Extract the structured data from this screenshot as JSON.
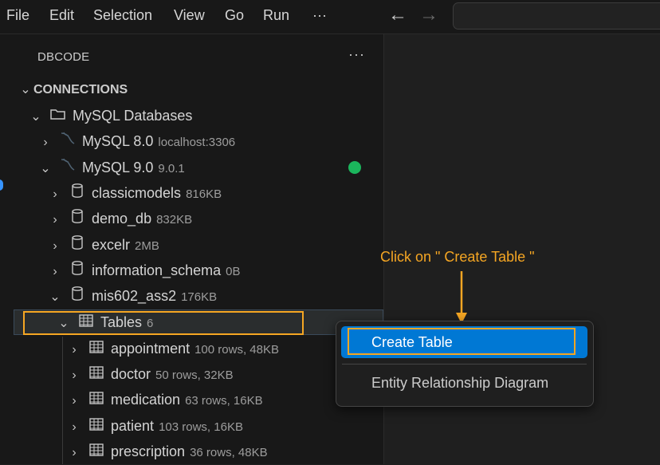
{
  "menubar": {
    "items": [
      "File",
      "Edit",
      "Selection",
      "View",
      "Go",
      "Run"
    ],
    "more": "···",
    "back": "←",
    "forward": "→"
  },
  "sidebar": {
    "title": "DBCODE",
    "more": "···",
    "section": "CONNECTIONS",
    "group": "MySQL Databases",
    "connections": [
      {
        "name": "MySQL 8.0",
        "desc": "localhost:3306",
        "expanded": false
      },
      {
        "name": "MySQL 9.0",
        "desc": "9.0.1",
        "expanded": true,
        "status_color": "#1bb55c"
      }
    ],
    "databases": [
      {
        "name": "classicmodels",
        "size": "816KB",
        "expanded": false
      },
      {
        "name": "demo_db",
        "size": "832KB",
        "expanded": false
      },
      {
        "name": "excelr",
        "size": "2MB",
        "expanded": false
      },
      {
        "name": "information_schema",
        "size": "0B",
        "expanded": false
      },
      {
        "name": "mis602_ass2",
        "size": "176KB",
        "expanded": true
      }
    ],
    "tables_node": {
      "label": "Tables",
      "count": "6"
    },
    "tables": [
      {
        "name": "appointment",
        "desc": "100 rows, 48KB"
      },
      {
        "name": "doctor",
        "desc": "50 rows, 32KB"
      },
      {
        "name": "medication",
        "desc": "63 rows, 16KB"
      },
      {
        "name": "patient",
        "desc": "103 rows, 16KB"
      },
      {
        "name": "prescription",
        "desc": "36 rows, 48KB"
      }
    ]
  },
  "context_menu": {
    "items": [
      "Create Table",
      "Entity Relationship Diagram"
    ],
    "highlighted_index": 0
  },
  "annotation": {
    "text": "Click on \" Create Table \"",
    "color": "#f5a623"
  },
  "icons": {
    "chevron_right": "chevron-right-icon",
    "chevron_down": "chevron-down-icon",
    "folder": "folder-open-icon",
    "mysql": "mysql-dolphin-icon",
    "database": "database-icon",
    "table": "table-grid-icon"
  },
  "colors": {
    "accent": "#0078d4",
    "annotation": "#f5a623",
    "status_connected": "#1bb55c"
  }
}
